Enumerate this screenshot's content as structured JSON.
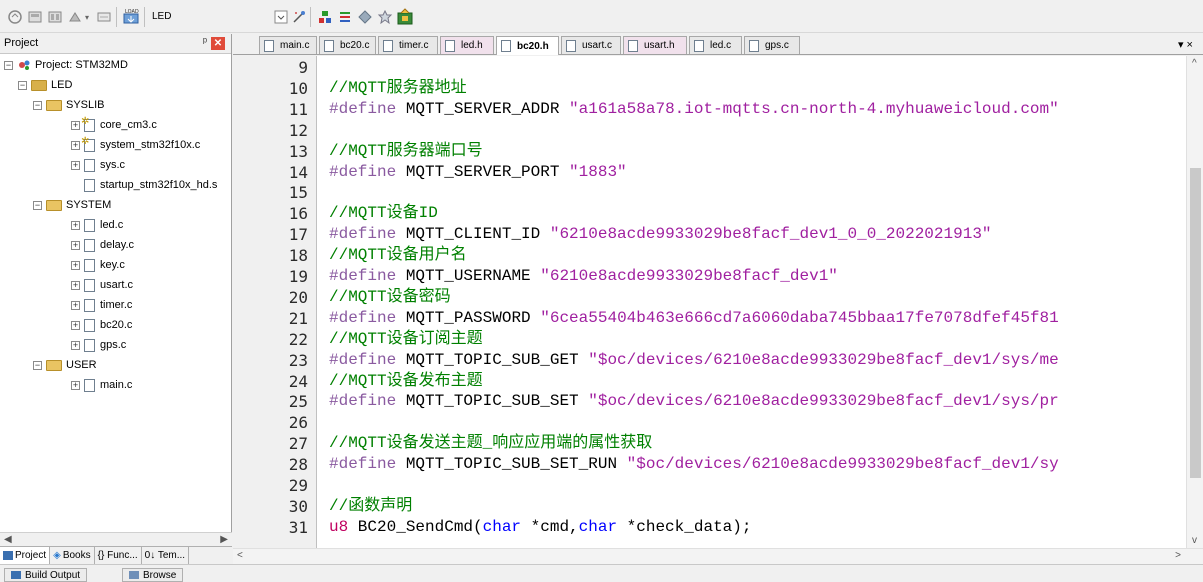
{
  "toolbar": {
    "target_label": "LED",
    "icons": [
      "build-icon",
      "rebuild-icon",
      "batch-build-icon",
      "translate-icon",
      "download-icon",
      "target-options-icon",
      "dropdown-icon",
      "wizard-icon",
      "pack-installer-icon",
      "books-icon",
      "manage-icon",
      "debug-icon"
    ]
  },
  "project_panel": {
    "title": "Project",
    "pin": "ᵖ",
    "close": "✕",
    "tree": {
      "root": "Project: STM32MD",
      "target": "LED",
      "groups": [
        {
          "name": "SYSLIB",
          "files": [
            "core_cm3.c",
            "system_stm32f10x.c",
            "sys.c",
            "startup_stm32f10x_hd.s"
          ]
        },
        {
          "name": "SYSTEM",
          "files": [
            "led.c",
            "delay.c",
            "key.c",
            "usart.c",
            "timer.c",
            "bc20.c",
            "gps.c"
          ]
        },
        {
          "name": "USER",
          "files": [
            "main.c"
          ]
        }
      ]
    },
    "tabs": [
      "Project",
      "Books",
      "{} Func...",
      "0↓ Tem..."
    ]
  },
  "bottom_tabs": [
    "Build Output",
    "Browse"
  ],
  "editor": {
    "tabs": [
      {
        "label": "main.c",
        "active": false,
        "kind": "c"
      },
      {
        "label": "bc20.c",
        "active": false,
        "kind": "c"
      },
      {
        "label": "timer.c",
        "active": false,
        "kind": "c"
      },
      {
        "label": "led.h",
        "active": false,
        "kind": "h"
      },
      {
        "label": "bc20.h",
        "active": true,
        "kind": "h"
      },
      {
        "label": "usart.c",
        "active": false,
        "kind": "c"
      },
      {
        "label": "usart.h",
        "active": false,
        "kind": "h"
      },
      {
        "label": "led.c",
        "active": false,
        "kind": "c"
      },
      {
        "label": "gps.c",
        "active": false,
        "kind": "c"
      }
    ],
    "tab_menu": "▾ ×",
    "lines": [
      {
        "n": "9",
        "segs": []
      },
      {
        "n": "10",
        "segs": [
          {
            "t": "//MQTT服务器地址",
            "c": "cmt"
          }
        ]
      },
      {
        "n": "11",
        "segs": [
          {
            "t": "#define",
            "c": "pp"
          },
          {
            "t": " MQTT_SERVER_ADDR ",
            "c": ""
          },
          {
            "t": "\"a161a58a78.iot-mqtts.cn-north-4.myhuaweicloud.com\"",
            "c": "str"
          }
        ]
      },
      {
        "n": "12",
        "segs": []
      },
      {
        "n": "13",
        "segs": [
          {
            "t": "//MQTT服务器端口号",
            "c": "cmt"
          }
        ]
      },
      {
        "n": "14",
        "segs": [
          {
            "t": "#define",
            "c": "pp"
          },
          {
            "t": " MQTT_SERVER_PORT ",
            "c": ""
          },
          {
            "t": "\"1883\"",
            "c": "str"
          }
        ]
      },
      {
        "n": "15",
        "segs": []
      },
      {
        "n": "16",
        "segs": [
          {
            "t": "//MQTT设备ID",
            "c": "cmt"
          }
        ]
      },
      {
        "n": "17",
        "segs": [
          {
            "t": "#define",
            "c": "pp"
          },
          {
            "t": " MQTT_CLIENT_ID ",
            "c": ""
          },
          {
            "t": "\"6210e8acde9933029be8facf_dev1_0_0_2022021913\"",
            "c": "str"
          }
        ]
      },
      {
        "n": "18",
        "segs": [
          {
            "t": "//MQTT设备用户名",
            "c": "cmt"
          }
        ]
      },
      {
        "n": "19",
        "segs": [
          {
            "t": "#define",
            "c": "pp"
          },
          {
            "t": " MQTT_USERNAME ",
            "c": ""
          },
          {
            "t": "\"6210e8acde9933029be8facf_dev1\"",
            "c": "str"
          }
        ]
      },
      {
        "n": "20",
        "segs": [
          {
            "t": "//MQTT设备密码",
            "c": "cmt"
          }
        ]
      },
      {
        "n": "21",
        "segs": [
          {
            "t": "#define",
            "c": "pp"
          },
          {
            "t": " MQTT_PASSWORD ",
            "c": ""
          },
          {
            "t": "\"6cea55404b463e666cd7a6060daba745bbaa17fe7078dfef45f81",
            "c": "str"
          }
        ]
      },
      {
        "n": "22",
        "segs": [
          {
            "t": "//MQTT设备订阅主题",
            "c": "cmt"
          }
        ]
      },
      {
        "n": "23",
        "segs": [
          {
            "t": "#define",
            "c": "pp"
          },
          {
            "t": " MQTT_TOPIC_SUB_GET ",
            "c": ""
          },
          {
            "t": "\"$oc/devices/6210e8acde9933029be8facf_dev1/sys/me",
            "c": "str"
          }
        ]
      },
      {
        "n": "24",
        "segs": [
          {
            "t": "//MQTT设备发布主题",
            "c": "cmt"
          }
        ]
      },
      {
        "n": "25",
        "segs": [
          {
            "t": "#define",
            "c": "pp"
          },
          {
            "t": " MQTT_TOPIC_SUB_SET ",
            "c": ""
          },
          {
            "t": "\"$oc/devices/6210e8acde9933029be8facf_dev1/sys/pr",
            "c": "str"
          }
        ]
      },
      {
        "n": "26",
        "segs": []
      },
      {
        "n": "27",
        "segs": [
          {
            "t": "//MQTT设备发送主题_响应应用端的属性获取",
            "c": "cmt"
          }
        ]
      },
      {
        "n": "28",
        "segs": [
          {
            "t": "#define",
            "c": "pp"
          },
          {
            "t": " MQTT_TOPIC_SUB_SET_RUN ",
            "c": ""
          },
          {
            "t": "\"$oc/devices/6210e8acde9933029be8facf_dev1/sy",
            "c": "str"
          }
        ]
      },
      {
        "n": "29",
        "segs": []
      },
      {
        "n": "30",
        "segs": [
          {
            "t": "//函数声明",
            "c": "cmt"
          }
        ]
      },
      {
        "n": "31",
        "segs": [
          {
            "t": "u8",
            "c": "ty"
          },
          {
            "t": " BC20_SendCmd(",
            "c": ""
          },
          {
            "t": "char",
            "c": "kw"
          },
          {
            "t": " *cmd,",
            "c": ""
          },
          {
            "t": "char",
            "c": "kw"
          },
          {
            "t": " *check_data);",
            "c": ""
          }
        ]
      }
    ]
  },
  "scrollbars": {
    "v_arrow_up": "^",
    "v_arrow_down": "v",
    "h_arrow_left": "<",
    "h_arrow_right": ">",
    "p_arrow_left": "◀",
    "p_arrow_right": "▶"
  }
}
